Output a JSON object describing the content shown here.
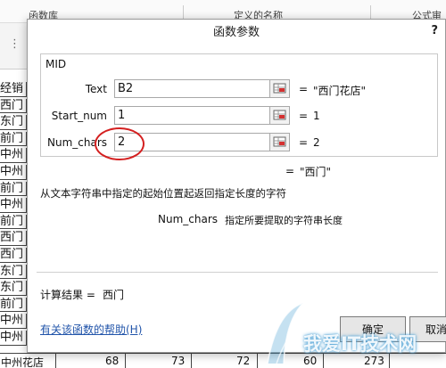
{
  "background": {
    "ribbon": [
      "函数库",
      "定义的名称",
      "公式审"
    ],
    "rows": [
      "经销",
      "西门",
      "东门",
      "前门",
      "中州",
      "中州",
      "前门",
      "中州",
      "前门",
      "西门",
      "西门",
      "东门",
      "东门",
      "前门",
      "中州",
      "中州"
    ],
    "bottom_row": {
      "name": "中州花店",
      "values": [
        "68",
        "73",
        "72",
        "60",
        "273"
      ]
    }
  },
  "dialog": {
    "title": "函数参数",
    "help": "?",
    "function_name": "MID",
    "args": [
      {
        "label": "Text",
        "value": "B2",
        "result": "\"西门花店\""
      },
      {
        "label": "Start_num",
        "value": "1",
        "result": "1"
      },
      {
        "label": "Num_chars",
        "value": "2",
        "result": "2"
      }
    ],
    "equals": "=",
    "formula_result": "\"西门\"",
    "description": "从文本字符串中指定的起始位置起返回指定长度的字符",
    "param_name": "Num_chars",
    "param_description": "指定所要提取的字符串长度",
    "calc_label": "计算结果 =",
    "calc_value": "西门",
    "help_link": "有关该函数的帮助(H)",
    "ok_label": "确定",
    "cancel_label": "取消"
  },
  "annotation_color": "#d42020",
  "watermark": "我爱IT技术网"
}
